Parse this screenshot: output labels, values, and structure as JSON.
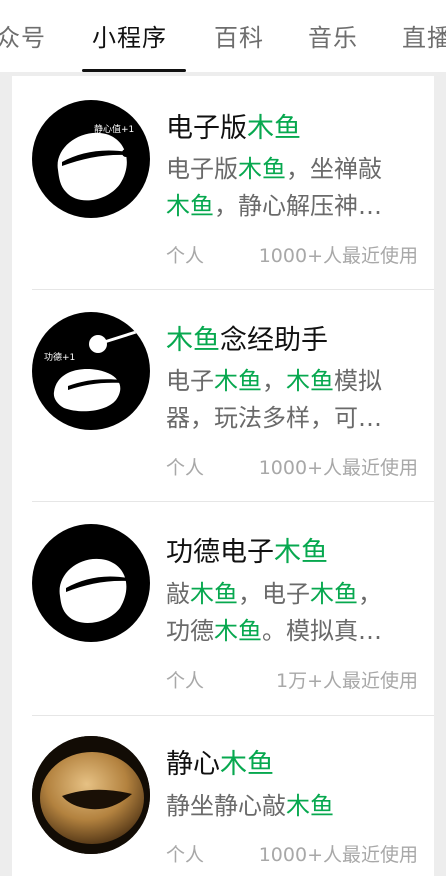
{
  "tabs": [
    "众号",
    "小程序",
    "百科",
    "音乐",
    "直播"
  ],
  "active_tab": "小程序",
  "highlight_color": "#07a84f",
  "results": [
    {
      "title_parts": [
        {
          "t": "电子版",
          "h": false
        },
        {
          "t": "木鱼",
          "h": true
        }
      ],
      "desc_lines": [
        [
          {
            "t": "电子版",
            "h": false
          },
          {
            "t": "木鱼",
            "h": true
          },
          {
            "t": "，坐禅敲",
            "h": false
          }
        ],
        [
          {
            "t": "木鱼",
            "h": true
          },
          {
            "t": "，静心解压神…",
            "h": false
          }
        ]
      ],
      "logo_caption": "静心值+1",
      "type": "个人",
      "usage": "1000+人最近使用"
    },
    {
      "title_parts": [
        {
          "t": "木鱼",
          "h": true
        },
        {
          "t": "念经助手",
          "h": false
        }
      ],
      "desc_lines": [
        [
          {
            "t": "电子",
            "h": false
          },
          {
            "t": "木鱼",
            "h": true
          },
          {
            "t": "，",
            "h": false
          },
          {
            "t": "木鱼",
            "h": true
          },
          {
            "t": "模拟",
            "h": false
          }
        ],
        [
          {
            "t": "器，玩法多样，可…",
            "h": false
          }
        ]
      ],
      "logo_caption": "功德+1",
      "type": "个人",
      "usage": "1000+人最近使用"
    },
    {
      "title_parts": [
        {
          "t": "功德电子",
          "h": false
        },
        {
          "t": "木鱼",
          "h": true
        }
      ],
      "desc_lines": [
        [
          {
            "t": "敲",
            "h": false
          },
          {
            "t": "木鱼",
            "h": true
          },
          {
            "t": "，电子",
            "h": false
          },
          {
            "t": "木鱼",
            "h": true
          },
          {
            "t": "，",
            "h": false
          }
        ],
        [
          {
            "t": "功德",
            "h": false
          },
          {
            "t": "木鱼",
            "h": true
          },
          {
            "t": "。模拟真…",
            "h": false
          }
        ]
      ],
      "logo_caption": "",
      "type": "个人",
      "usage": "1万+人最近使用"
    },
    {
      "title_parts": [
        {
          "t": "静心",
          "h": false
        },
        {
          "t": "木鱼",
          "h": true
        }
      ],
      "desc_lines": [
        [
          {
            "t": "静坐静心敲",
            "h": false
          },
          {
            "t": "木鱼",
            "h": true
          }
        ]
      ],
      "logo_caption": "",
      "type": "个人",
      "usage": "1000+人最近使用"
    }
  ]
}
